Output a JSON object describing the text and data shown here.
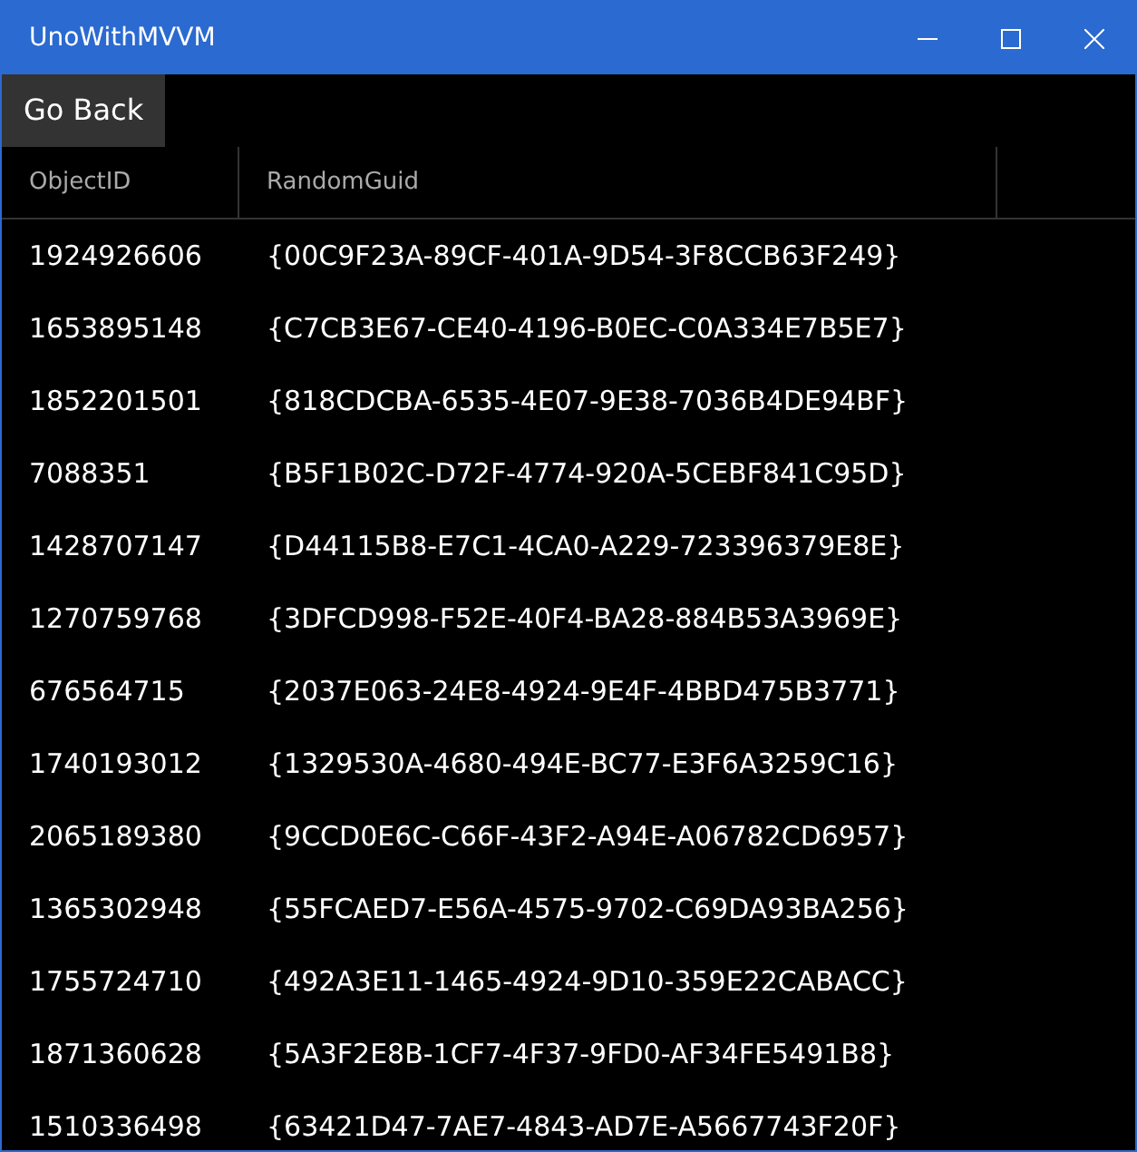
{
  "window": {
    "title": "UnoWithMVVM"
  },
  "back_button": {
    "label": "Go Back"
  },
  "table": {
    "columns": [
      "ObjectID",
      "RandomGuid"
    ],
    "rows": [
      [
        "1924926606",
        "{00C9F23A-89CF-401A-9D54-3F8CCB63F249}"
      ],
      [
        "1653895148",
        "{C7CB3E67-CE40-4196-B0EC-C0A334E7B5E7}"
      ],
      [
        "1852201501",
        "{818CDCBA-6535-4E07-9E38-7036B4DE94BF}"
      ],
      [
        "7088351",
        "{B5F1B02C-D72F-4774-920A-5CEBF841C95D}"
      ],
      [
        "1428707147",
        "{D44115B8-E7C1-4CA0-A229-723396379E8E}"
      ],
      [
        "1270759768",
        "{3DFCD998-F52E-40F4-BA28-884B53A3969E}"
      ],
      [
        "676564715",
        "{2037E063-24E8-4924-9E4F-4BBD475B3771}"
      ],
      [
        "1740193012",
        "{1329530A-4680-494E-BC77-E3F6A3259C16}"
      ],
      [
        "2065189380",
        "{9CCD0E6C-C66F-43F2-A94E-A06782CD6957}"
      ],
      [
        "1365302948",
        "{55FCAED7-E56A-4575-9702-C69DA93BA256}"
      ],
      [
        "1755724710",
        "{492A3E11-1465-4924-9D10-359E22CABACC}"
      ],
      [
        "1871360628",
        "{5A3F2E8B-1CF7-4F37-9FD0-AF34FE5491B8}"
      ],
      [
        "1510336498",
        "{63421D47-7AE7-4843-AD7E-A5667743F20F}"
      ]
    ]
  }
}
